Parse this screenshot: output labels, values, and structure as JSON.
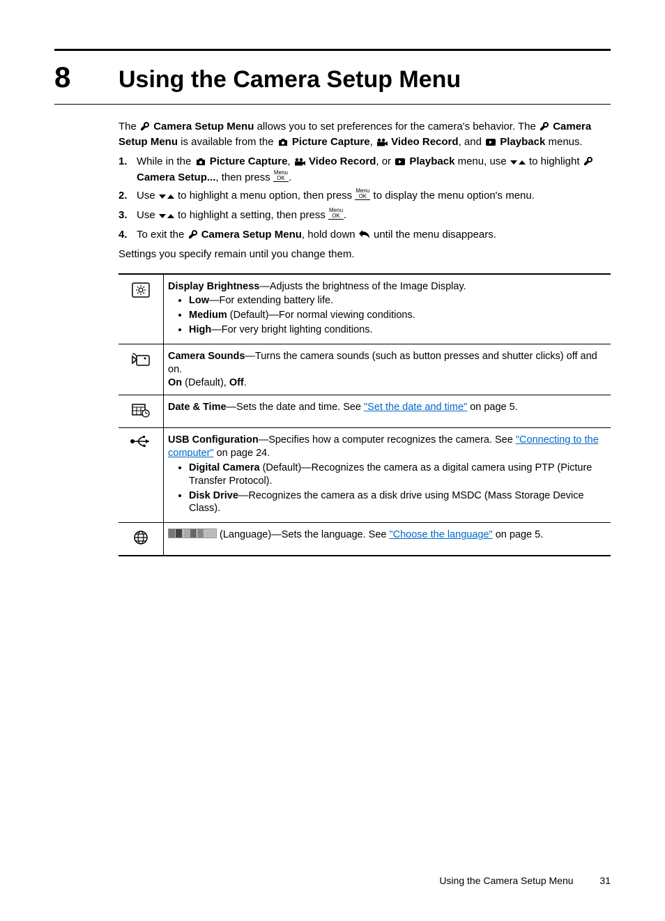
{
  "chapter": {
    "number": "8",
    "title": "Using the Camera Setup Menu"
  },
  "intro": {
    "p1a": "The ",
    "p1b": " Camera Setup Menu",
    "p1c": " allows you to set preferences for the camera's behavior. The ",
    "p1d": " Camera Setup Menu",
    "p1e": " is available from the ",
    "p1f": " Picture Capture",
    "p1g": ", ",
    "p1h": " Video Record",
    "p1i": ", and ",
    "p1j": " Playback",
    "p1k": " menus."
  },
  "steps": {
    "s1": {
      "n": "1.",
      "a": "While in the ",
      "b": " Picture Capture",
      "c": ", ",
      "d": " Video Record",
      "e": ", or ",
      "f": " Playback",
      "g": " menu, use ",
      "h": " to highlight ",
      "i": " Camera Setup...",
      "j": ", then press ",
      "k": "."
    },
    "s2": {
      "n": "2.",
      "a": "Use ",
      "b": " to highlight a menu option, then press ",
      "c": " to display the menu option's menu."
    },
    "s3": {
      "n": "3.",
      "a": "Use ",
      "b": " to highlight a setting, then press ",
      "c": "."
    },
    "s4": {
      "n": "4.",
      "a": "To exit the ",
      "b": " Camera Setup Menu",
      "c": ", hold down ",
      "d": " until the menu disappears."
    }
  },
  "after_steps": "Settings you specify remain until you change them.",
  "table": {
    "r1": {
      "title": "Display Brightness",
      "desc": "—Adjusts the brightness of the Image Display.",
      "opts": [
        {
          "b": "Low",
          "t": "—For extending battery life."
        },
        {
          "b": "Medium",
          "t": " (Default)—For normal viewing conditions."
        },
        {
          "b": "High",
          "t": "—For very bright lighting conditions."
        }
      ]
    },
    "r2": {
      "title": "Camera Sounds",
      "desc": "—Turns the camera sounds (such as button presses and shutter clicks) off and on.",
      "line2a": "On",
      "line2b": " (Default), ",
      "line2c": "Off",
      "line2d": "."
    },
    "r3": {
      "title": "Date & Time",
      "desc": "—Sets the date and time. See ",
      "link": "\"Set the date and time\"",
      "after": " on page 5."
    },
    "r4": {
      "title": "USB Configuration",
      "desc": "—Specifies how a computer recognizes the camera. See ",
      "link": "\"Connecting to the computer\"",
      "after": " on page 24.",
      "opts": [
        {
          "b": "Digital Camera",
          "t": "  (Default)—Recognizes the camera as a digital camera using PTP (Picture Transfer Protocol)."
        },
        {
          "b": "Disk Drive",
          "t": "—Recognizes the camera as a disk drive using MSDC (Mass Storage Device Class)."
        }
      ]
    },
    "r5": {
      "mid": " (Language)—Sets the language. See ",
      "link": "\"Choose the language\"",
      "after": " on page 5."
    }
  },
  "footer": {
    "text": "Using the Camera Setup Menu",
    "page": "31"
  }
}
